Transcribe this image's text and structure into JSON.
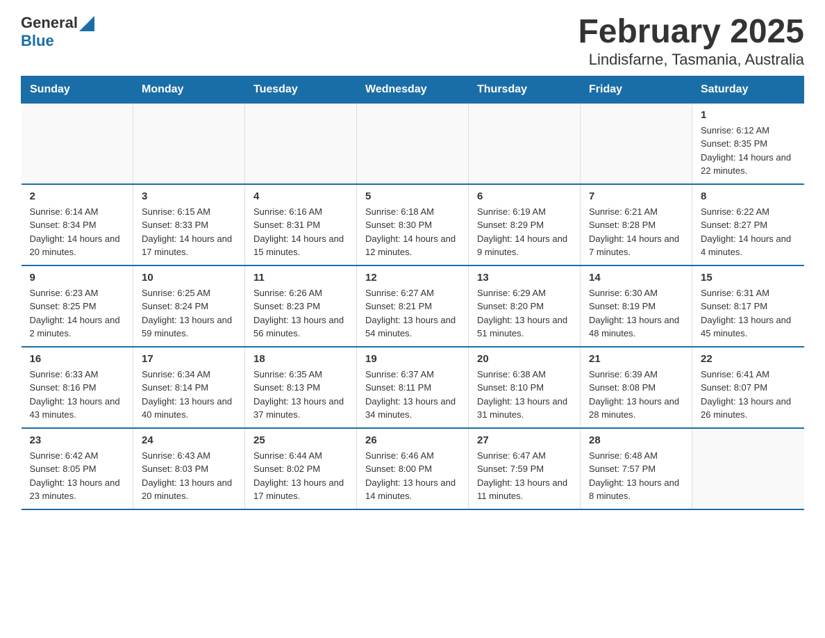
{
  "header": {
    "logo_general": "General",
    "logo_blue": "Blue",
    "title": "February 2025",
    "subtitle": "Lindisfarne, Tasmania, Australia"
  },
  "days_of_week": [
    "Sunday",
    "Monday",
    "Tuesday",
    "Wednesday",
    "Thursday",
    "Friday",
    "Saturday"
  ],
  "weeks": [
    [
      {
        "day": "",
        "sunrise": "",
        "sunset": "",
        "daylight": ""
      },
      {
        "day": "",
        "sunrise": "",
        "sunset": "",
        "daylight": ""
      },
      {
        "day": "",
        "sunrise": "",
        "sunset": "",
        "daylight": ""
      },
      {
        "day": "",
        "sunrise": "",
        "sunset": "",
        "daylight": ""
      },
      {
        "day": "",
        "sunrise": "",
        "sunset": "",
        "daylight": ""
      },
      {
        "day": "",
        "sunrise": "",
        "sunset": "",
        "daylight": ""
      },
      {
        "day": "1",
        "sunrise": "Sunrise: 6:12 AM",
        "sunset": "Sunset: 8:35 PM",
        "daylight": "Daylight: 14 hours and 22 minutes."
      }
    ],
    [
      {
        "day": "2",
        "sunrise": "Sunrise: 6:14 AM",
        "sunset": "Sunset: 8:34 PM",
        "daylight": "Daylight: 14 hours and 20 minutes."
      },
      {
        "day": "3",
        "sunrise": "Sunrise: 6:15 AM",
        "sunset": "Sunset: 8:33 PM",
        "daylight": "Daylight: 14 hours and 17 minutes."
      },
      {
        "day": "4",
        "sunrise": "Sunrise: 6:16 AM",
        "sunset": "Sunset: 8:31 PM",
        "daylight": "Daylight: 14 hours and 15 minutes."
      },
      {
        "day": "5",
        "sunrise": "Sunrise: 6:18 AM",
        "sunset": "Sunset: 8:30 PM",
        "daylight": "Daylight: 14 hours and 12 minutes."
      },
      {
        "day": "6",
        "sunrise": "Sunrise: 6:19 AM",
        "sunset": "Sunset: 8:29 PM",
        "daylight": "Daylight: 14 hours and 9 minutes."
      },
      {
        "day": "7",
        "sunrise": "Sunrise: 6:21 AM",
        "sunset": "Sunset: 8:28 PM",
        "daylight": "Daylight: 14 hours and 7 minutes."
      },
      {
        "day": "8",
        "sunrise": "Sunrise: 6:22 AM",
        "sunset": "Sunset: 8:27 PM",
        "daylight": "Daylight: 14 hours and 4 minutes."
      }
    ],
    [
      {
        "day": "9",
        "sunrise": "Sunrise: 6:23 AM",
        "sunset": "Sunset: 8:25 PM",
        "daylight": "Daylight: 14 hours and 2 minutes."
      },
      {
        "day": "10",
        "sunrise": "Sunrise: 6:25 AM",
        "sunset": "Sunset: 8:24 PM",
        "daylight": "Daylight: 13 hours and 59 minutes."
      },
      {
        "day": "11",
        "sunrise": "Sunrise: 6:26 AM",
        "sunset": "Sunset: 8:23 PM",
        "daylight": "Daylight: 13 hours and 56 minutes."
      },
      {
        "day": "12",
        "sunrise": "Sunrise: 6:27 AM",
        "sunset": "Sunset: 8:21 PM",
        "daylight": "Daylight: 13 hours and 54 minutes."
      },
      {
        "day": "13",
        "sunrise": "Sunrise: 6:29 AM",
        "sunset": "Sunset: 8:20 PM",
        "daylight": "Daylight: 13 hours and 51 minutes."
      },
      {
        "day": "14",
        "sunrise": "Sunrise: 6:30 AM",
        "sunset": "Sunset: 8:19 PM",
        "daylight": "Daylight: 13 hours and 48 minutes."
      },
      {
        "day": "15",
        "sunrise": "Sunrise: 6:31 AM",
        "sunset": "Sunset: 8:17 PM",
        "daylight": "Daylight: 13 hours and 45 minutes."
      }
    ],
    [
      {
        "day": "16",
        "sunrise": "Sunrise: 6:33 AM",
        "sunset": "Sunset: 8:16 PM",
        "daylight": "Daylight: 13 hours and 43 minutes."
      },
      {
        "day": "17",
        "sunrise": "Sunrise: 6:34 AM",
        "sunset": "Sunset: 8:14 PM",
        "daylight": "Daylight: 13 hours and 40 minutes."
      },
      {
        "day": "18",
        "sunrise": "Sunrise: 6:35 AM",
        "sunset": "Sunset: 8:13 PM",
        "daylight": "Daylight: 13 hours and 37 minutes."
      },
      {
        "day": "19",
        "sunrise": "Sunrise: 6:37 AM",
        "sunset": "Sunset: 8:11 PM",
        "daylight": "Daylight: 13 hours and 34 minutes."
      },
      {
        "day": "20",
        "sunrise": "Sunrise: 6:38 AM",
        "sunset": "Sunset: 8:10 PM",
        "daylight": "Daylight: 13 hours and 31 minutes."
      },
      {
        "day": "21",
        "sunrise": "Sunrise: 6:39 AM",
        "sunset": "Sunset: 8:08 PM",
        "daylight": "Daylight: 13 hours and 28 minutes."
      },
      {
        "day": "22",
        "sunrise": "Sunrise: 6:41 AM",
        "sunset": "Sunset: 8:07 PM",
        "daylight": "Daylight: 13 hours and 26 minutes."
      }
    ],
    [
      {
        "day": "23",
        "sunrise": "Sunrise: 6:42 AM",
        "sunset": "Sunset: 8:05 PM",
        "daylight": "Daylight: 13 hours and 23 minutes."
      },
      {
        "day": "24",
        "sunrise": "Sunrise: 6:43 AM",
        "sunset": "Sunset: 8:03 PM",
        "daylight": "Daylight: 13 hours and 20 minutes."
      },
      {
        "day": "25",
        "sunrise": "Sunrise: 6:44 AM",
        "sunset": "Sunset: 8:02 PM",
        "daylight": "Daylight: 13 hours and 17 minutes."
      },
      {
        "day": "26",
        "sunrise": "Sunrise: 6:46 AM",
        "sunset": "Sunset: 8:00 PM",
        "daylight": "Daylight: 13 hours and 14 minutes."
      },
      {
        "day": "27",
        "sunrise": "Sunrise: 6:47 AM",
        "sunset": "Sunset: 7:59 PM",
        "daylight": "Daylight: 13 hours and 11 minutes."
      },
      {
        "day": "28",
        "sunrise": "Sunrise: 6:48 AM",
        "sunset": "Sunset: 7:57 PM",
        "daylight": "Daylight: 13 hours and 8 minutes."
      },
      {
        "day": "",
        "sunrise": "",
        "sunset": "",
        "daylight": ""
      }
    ]
  ]
}
